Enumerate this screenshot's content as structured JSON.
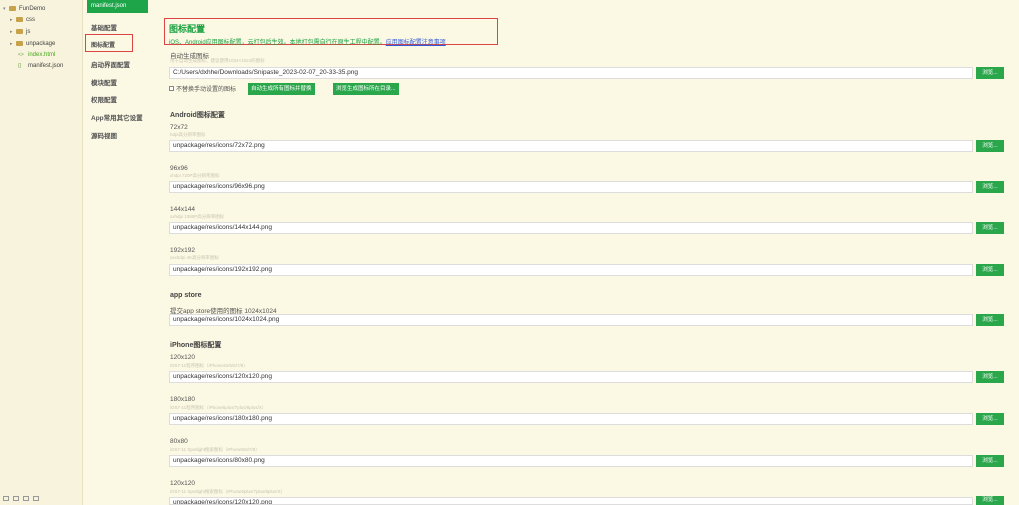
{
  "file_tree": {
    "items": [
      {
        "label": "FunDemo",
        "kind": "project"
      },
      {
        "label": "css",
        "kind": "folder"
      },
      {
        "label": "js",
        "kind": "folder"
      },
      {
        "label": "unpackage",
        "kind": "folder"
      },
      {
        "label": "index.html",
        "kind": "file"
      },
      {
        "label": "manifest.json",
        "kind": "file"
      }
    ]
  },
  "tab": {
    "label": "manifest.json"
  },
  "nav": {
    "items": [
      "基础配置",
      "图标配置",
      "启动界面配置",
      "模块配置",
      "权限配置",
      "App常用其它设置",
      "源码视图"
    ],
    "active": "图标配置"
  },
  "header": {
    "title": "图标配置",
    "desc": "iOS、Android应用图标配置，云打包后生效。本地打包需自行在原生工程中配置。",
    "link": "应用图标配置注意事项"
  },
  "auto": {
    "label": "自动生成图标",
    "sub": "用于自动生成图标，建议使用1024×1024的图标",
    "value": "C:/Users/dxhhe/Downloads/Snipaste_2023-02-07_20-33-35.png",
    "checkbox_label": "不替换手动设置的图标",
    "btn_generate": "自动生成所有图标并替换",
    "btn_browse_dir": "浏览生成图标所在目录..."
  },
  "browse_label": "浏览...",
  "android": {
    "title": "Android图标配置",
    "fields": [
      {
        "label": "72x72",
        "sub": "hdpi高分辨率图标",
        "value": "unpackage/res/icons/72x72.png"
      },
      {
        "label": "96x96",
        "sub": "xhdpi 720P高分辨率图标",
        "value": "unpackage/res/icons/96x96.png"
      },
      {
        "label": "144x144",
        "sub": "xxhdpi 1080P高分辨率图标",
        "value": "unpackage/res/icons/144x144.png"
      },
      {
        "label": "192x192",
        "sub": "xxxhdpi 4K高分辨率图标",
        "value": "unpackage/res/icons/192x192.png"
      }
    ]
  },
  "appstore": {
    "title": "app store",
    "label": "提交app store使用的图标 1024x1024",
    "value": "unpackage/res/icons/1024x1024.png"
  },
  "iphone": {
    "title": "iPhone图标配置",
    "fields": [
      {
        "label": "120x120",
        "sub": "iOS7-11程序图标（iPhone4S/5/6/7/8）",
        "value": "unpackage/res/icons/120x120.png"
      },
      {
        "label": "180x180",
        "sub": "iOS7-11程序图标（iPhone6plus/7plus/8plus/X）",
        "value": "unpackage/res/icons/180x180.png"
      },
      {
        "label": "80x80",
        "sub": "iOS7-11 Spotlight搜索图标（iPhone5/6/7/8）",
        "value": "unpackage/res/icons/80x80.png"
      },
      {
        "label": "120x120",
        "sub": "iOS7-11 Spotlight搜索图标（iPhone6plus/7plus/8plus/X）",
        "value": "unpackage/res/icons/120x120.png"
      }
    ]
  }
}
